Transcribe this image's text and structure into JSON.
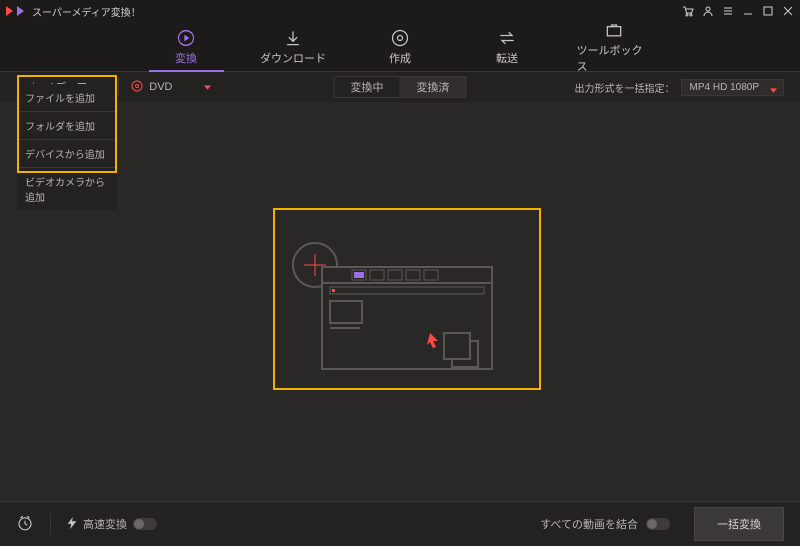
{
  "app": {
    "title": "スーパーメディア変換！"
  },
  "window_buttons": [
    "cart",
    "user",
    "menu",
    "minimize",
    "maximize",
    "close"
  ],
  "nav": {
    "active": 0,
    "items": [
      {
        "id": "convert",
        "label": "変換"
      },
      {
        "id": "download",
        "label": "ダウンロード"
      },
      {
        "id": "create",
        "label": "作成"
      },
      {
        "id": "transfer",
        "label": "転送"
      },
      {
        "id": "toolbox",
        "label": "ツールボックス"
      }
    ]
  },
  "toolbar": {
    "media_button_label": "メディア",
    "media_menu": [
      "ファイルを追加",
      "フォルダを追加",
      "デバイスから追加",
      "ビデオカメラから追加"
    ],
    "dvd_label": "DVD",
    "tabs": {
      "in_progress": "変換中",
      "done": "変換済",
      "active": "done"
    },
    "output_format_label": "出力形式を一括指定：",
    "output_format_value": "MP4 HD 1080P"
  },
  "bottom": {
    "high_speed_label": "高速変換",
    "high_speed_on": false,
    "merge_label": "すべての動画を結合",
    "merge_on": false,
    "convert_button_label": "一括変換"
  },
  "colors": {
    "accent": "#9d6fe6",
    "danger": "#ff4a4a",
    "highlight": "#f3b200"
  }
}
